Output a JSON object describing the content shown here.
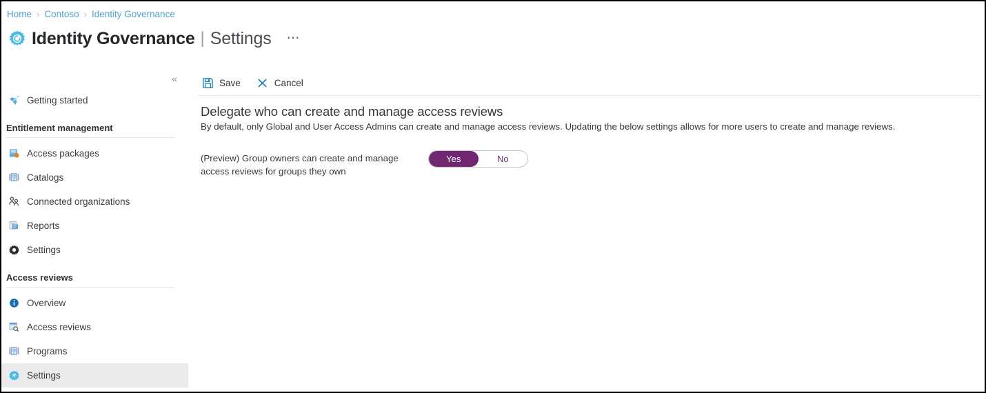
{
  "breadcrumb": {
    "separator": "›",
    "items": [
      "Home",
      "Contoso",
      "Identity Governance"
    ]
  },
  "header": {
    "icon": "identity-governance-gear-icon",
    "title": "Identity Governance",
    "separator": "|",
    "subtitle": "Settings",
    "more_label": "⋯",
    "accent_cyan": "#3fbbe8"
  },
  "sidebar": {
    "collapse_icon": "«",
    "groups": [
      {
        "section": null,
        "items": [
          {
            "label": "Getting started",
            "icon": "rocket-icon",
            "selected": false
          }
        ]
      },
      {
        "section": "Entitlement management",
        "items": [
          {
            "label": "Access packages",
            "icon": "access-package-icon",
            "selected": false
          },
          {
            "label": "Catalogs",
            "icon": "catalog-book-icon",
            "selected": false
          },
          {
            "label": "Connected organizations",
            "icon": "people-icon",
            "selected": false
          },
          {
            "label": "Reports",
            "icon": "reports-icon",
            "selected": false
          },
          {
            "label": "Settings",
            "icon": "gear-dark-icon",
            "selected": false
          }
        ]
      },
      {
        "section": "Access reviews",
        "items": [
          {
            "label": "Overview",
            "icon": "info-circle-icon",
            "selected": false
          },
          {
            "label": "Access reviews",
            "icon": "grid-search-icon",
            "selected": false
          },
          {
            "label": "Programs",
            "icon": "catalog-book-icon",
            "selected": false
          },
          {
            "label": "Settings",
            "icon": "gear-cyan-icon",
            "selected": true
          }
        ]
      }
    ],
    "selected_bg": "#ebebeb"
  },
  "toolbar": {
    "save_label": "Save",
    "save_icon": "save-disk-icon",
    "cancel_label": "Cancel",
    "cancel_icon": "close-x-icon",
    "icon_color": "#0078d4"
  },
  "main": {
    "heading": "Delegate who can create and manage access reviews",
    "description": "By default, only Global and User Access Admins can create and manage access reviews. Updating the below settings allows for more users to create and manage reviews.",
    "setting": {
      "label": "(Preview) Group owners can create and manage access reviews for groups they own",
      "toggle": {
        "yes_label": "Yes",
        "no_label": "No",
        "value": "Yes",
        "on_color": "#702670",
        "off_text_color": "#7a2b7d"
      }
    }
  }
}
